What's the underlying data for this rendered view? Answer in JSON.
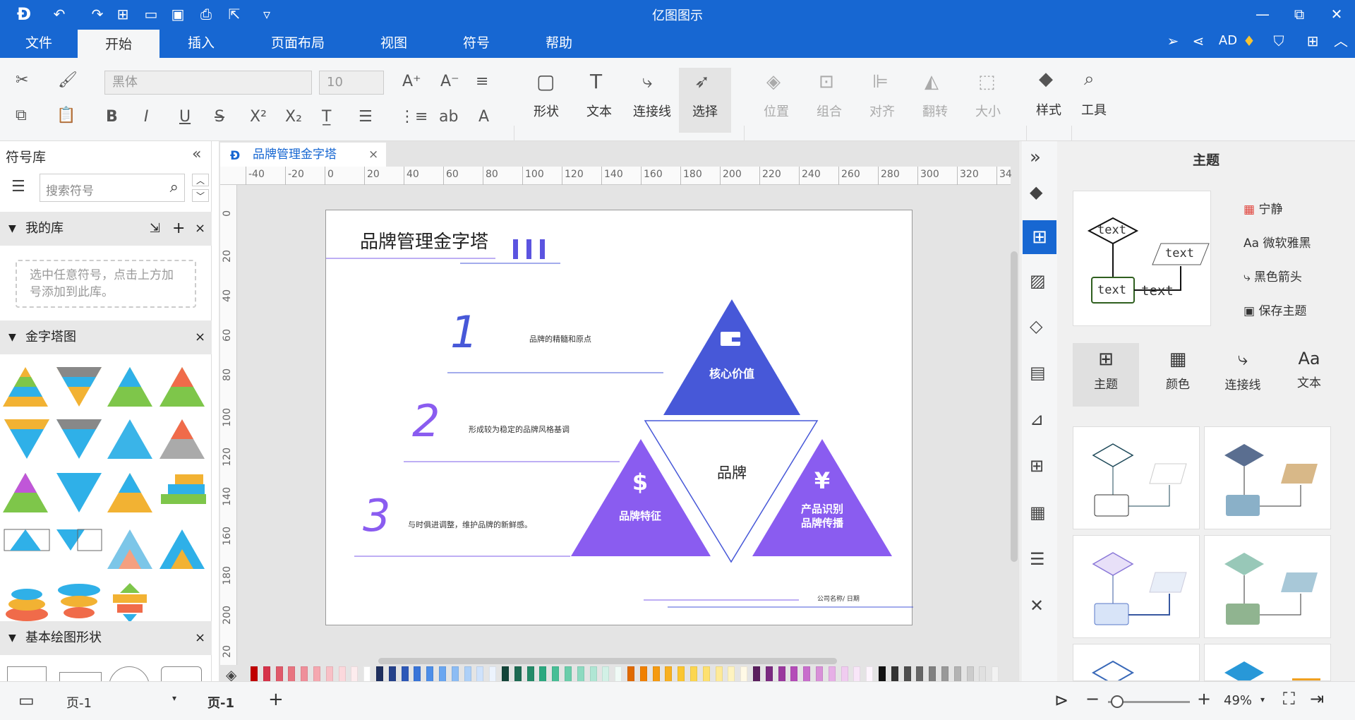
{
  "app": {
    "title": "亿图图示"
  },
  "menu_tabs": [
    "文件",
    "开始",
    "插入",
    "页面布局",
    "视图",
    "符号",
    "帮助"
  ],
  "account": {
    "label": "AD"
  },
  "ribbon": {
    "font_name": "黑体",
    "font_size": "10",
    "big_buttons": [
      "形状",
      "文本",
      "连接线",
      "选择",
      "位置",
      "组合",
      "对齐",
      "翻转",
      "大小",
      "样式",
      "工具"
    ]
  },
  "symbol_panel": {
    "title": "符号库",
    "search_placeholder": "搜索符号",
    "my_library": "我的库",
    "my_library_hint": "选中任意符号，点击上方加号添加到此库。",
    "pyramid_section": "金字塔图",
    "basic_section": "基本绘图形状"
  },
  "document": {
    "tab_title": "品牌管理金字塔",
    "slide": {
      "title": "品牌管理金字塔",
      "items": [
        {
          "num": "1",
          "text": "品牌的精髓和原点"
        },
        {
          "num": "2",
          "text": "形成较为稳定的品牌风格基调"
        },
        {
          "num": "3",
          "text": "与时俱进调整，维护品牌的新鲜感。"
        }
      ],
      "top_label": "核心价值",
      "center_label": "品牌",
      "left_label": "品牌特征",
      "right_label_1": "产品识别",
      "right_label_2": "品牌传播",
      "footer": "公司名称/ 日期"
    }
  },
  "rulers": {
    "h": [
      "-40",
      "-20",
      "0",
      "20",
      "40",
      "60",
      "80",
      "100",
      "120",
      "140",
      "160",
      "180",
      "200",
      "220",
      "240",
      "260",
      "280",
      "300",
      "320",
      "34"
    ],
    "v": [
      "0",
      "20",
      "40",
      "60",
      "80",
      "100",
      "120",
      "140",
      "160",
      "180",
      "200",
      "20"
    ]
  },
  "theme_panel": {
    "title": "主题",
    "preview_texts": [
      "text",
      "text",
      "text",
      "text"
    ],
    "options": [
      "宁静",
      "微软雅黑",
      "黑色箭头",
      "保存主题"
    ],
    "tabs": [
      "主题",
      "颜色",
      "连接线",
      "文本"
    ]
  },
  "status": {
    "page_select": "页-1",
    "page_tab": "页-1",
    "zoom": "49%"
  },
  "colors": {
    "brand_blue": "#1767d2",
    "pyramid_blue": "#4758d8",
    "pyramid_purple": "#8a5cf0",
    "number_purple": "#7a4fe0"
  }
}
